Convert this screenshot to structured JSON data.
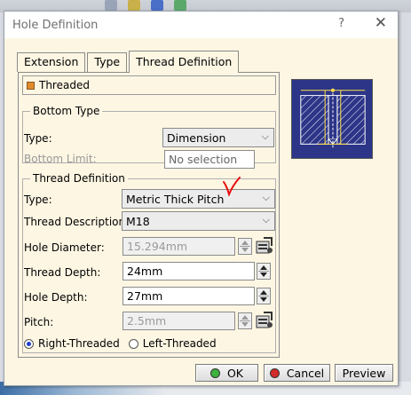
{
  "window": {
    "title": "Hole Definition",
    "help": "?",
    "close": "✕"
  },
  "tabs": [
    {
      "label": "Extension",
      "active": false
    },
    {
      "label": "Type",
      "active": false
    },
    {
      "label": "Thread Definition",
      "active": true
    }
  ],
  "threaded": {
    "label": "Threaded",
    "checked": true
  },
  "bottom_type": {
    "legend": "Bottom Type",
    "type_label": "Type:",
    "type_value": "Dimension",
    "limit_label": "Bottom Limit:",
    "limit_value": "No selection"
  },
  "thread_definition": {
    "legend": "Thread Definition",
    "type_label": "Type:",
    "type_value": "Metric Thick Pitch",
    "desc_label": "Thread Description:",
    "desc_value": "M18",
    "hole_diameter_label": "Hole Diameter:",
    "hole_diameter_value": "15.294mm",
    "thread_depth_label": "Thread Depth:",
    "thread_depth_value": "24mm",
    "hole_depth_label": "Hole Depth:",
    "hole_depth_value": "27mm",
    "pitch_label": "Pitch:",
    "pitch_value": "2.5mm",
    "right_threaded_label": "Right-Threaded",
    "left_threaded_label": "Left-Threaded",
    "selected_direction": "right"
  },
  "buttons": {
    "ok": "OK",
    "cancel": "Cancel",
    "preview": "Preview"
  },
  "colors": {
    "dialog_bg": "#fdf6e3",
    "preview_bg": "#2c3588",
    "annotation": "#e81010"
  }
}
